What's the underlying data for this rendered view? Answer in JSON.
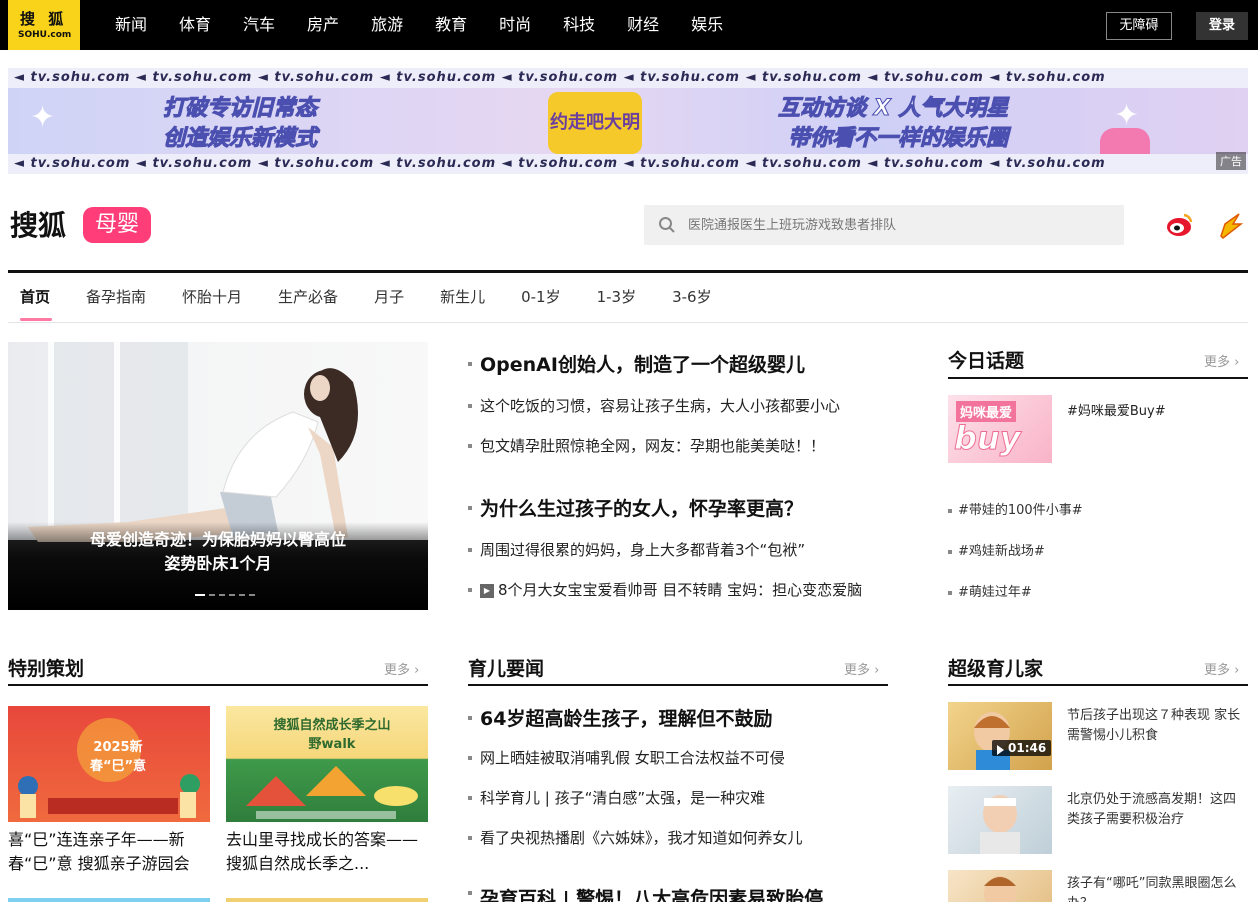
{
  "topbar": {
    "logo_cn": "搜 狐",
    "logo_en": "SOHU.com",
    "nav": [
      "新闻",
      "体育",
      "汽车",
      "房产",
      "旅游",
      "教育",
      "时尚",
      "科技",
      "财经",
      "娱乐"
    ],
    "accessibility": "无障碍",
    "login": "登录"
  },
  "banner": {
    "strip_text": "◄ tv.sohu.com ◄ tv.sohu.com ◄ tv.sohu.com ◄ tv.sohu.com ◄ tv.sohu.com ◄ tv.sohu.com ◄ tv.sohu.com ◄ tv.sohu.com ◄ tv.sohu.com",
    "line1": "打破专访旧常态",
    "line2": "创造娱乐新模式",
    "line3": "互动访谈 X 人气大明星",
    "line4": "带你看不一样的娱乐圈",
    "badge": "约走吧大明星",
    "ad_label": "广告"
  },
  "channel": {
    "site": "搜狐",
    "tag": "母婴",
    "search_placeholder": "医院通报医生上班玩游戏致患者排队"
  },
  "tabs": [
    "首页",
    "备孕指南",
    "怀胎十月",
    "生产必备",
    "月子",
    "新生儿",
    "0-1岁",
    "1-3岁",
    "3-6岁"
  ],
  "hero": {
    "caption_line1": "母爱创造奇迹！为保胎妈妈以臀高位",
    "caption_line2": "姿势卧床1个月"
  },
  "headlines": [
    {
      "text": "OpenAI创始人，制造了一个超级婴儿",
      "big": true
    },
    {
      "text": "这个吃饭的习惯，容易让孩子生病，大人小孩都要小心",
      "big": false
    },
    {
      "text": "包文婧孕肚照惊艳全网，网友：孕期也能美美哒！！",
      "big": false
    },
    {
      "text": "为什么生过孩子的女人，怀孕率更高？",
      "big": true
    },
    {
      "text": "周围过得很累的妈妈，身上大多都背着3个“包袱”",
      "big": false
    },
    {
      "text": "8个月大女宝宝爱看帅哥 目不转睛 宝妈：担心变恋爱脑",
      "big": false,
      "video": true
    }
  ],
  "today": {
    "title": "今日话题",
    "more": "更多",
    "feature_img_text1": "妈咪最爱",
    "feature_img_text2": "buy",
    "feature": "#妈咪最爱Buy#",
    "topics": [
      "#带娃的100件小事#",
      "#鸡娃新战场#",
      "#萌娃过年#"
    ]
  },
  "special": {
    "title": "特别策划",
    "more": "更多",
    "cards": [
      {
        "title": "喜“巳”连连亲子年——新春“巳”意 搜狐亲子游园会",
        "img_text": "2025新春“巳”意"
      },
      {
        "title": "去山里寻找成长的答案——搜狐自然成长季之...",
        "img_text": "搜狐自然成长季之山野walk"
      }
    ]
  },
  "news": {
    "title": "育儿要闻",
    "more": "更多",
    "items": [
      {
        "text": "64岁超高龄生孩子，理解但不鼓励",
        "big": true
      },
      {
        "text": "网上晒娃被取消哺乳假 女职工合法权益不可侵",
        "big": false
      },
      {
        "text": "科学育儿 | 孩子“清白感”太强，是一种灾难",
        "big": false
      },
      {
        "text": "看了央视热播剧《六姊妹》，我才知道如何养女儿",
        "big": false
      },
      {
        "text": "孕育百科 | 警惕！八大高危因素易致胎停",
        "big": true
      }
    ]
  },
  "kids": {
    "title": "超级育儿家",
    "more": "更多",
    "items": [
      {
        "text": "节后孩子出现这７种表现 家长需警惕小儿积食",
        "duration": "01:46"
      },
      {
        "text": "北京仍处于流感高发期！这四类孩子需要积极治疗"
      },
      {
        "text": "孩子有“哪吒”同款黑眼圈怎么办？"
      }
    ]
  }
}
